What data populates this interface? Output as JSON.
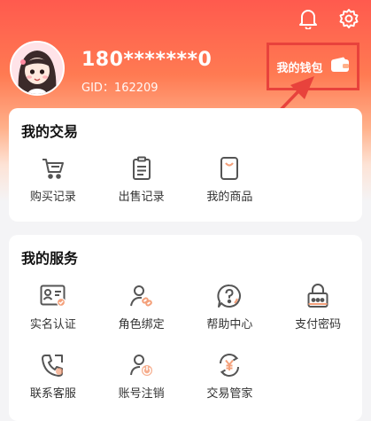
{
  "header": {
    "username": "180*******0",
    "gid": "GID：162209",
    "wallet_label": "我的钱包"
  },
  "top_icons": [
    "bell-icon",
    "gear-icon"
  ],
  "trade": {
    "title": "我的交易",
    "items": [
      {
        "label": "购买记录",
        "icon": "cart-icon"
      },
      {
        "label": "出售记录",
        "icon": "clipboard-icon"
      },
      {
        "label": "我的商品",
        "icon": "bag-icon"
      }
    ]
  },
  "service": {
    "title": "我的服务",
    "items": [
      {
        "label": "实名认证",
        "icon": "id-card-icon"
      },
      {
        "label": "角色绑定",
        "icon": "user-link-icon"
      },
      {
        "label": "帮助中心",
        "icon": "help-icon"
      },
      {
        "label": "支付密码",
        "icon": "lock-icon"
      },
      {
        "label": "联系客服",
        "icon": "phone-icon"
      },
      {
        "label": "账号注销",
        "icon": "user-power-icon"
      },
      {
        "label": "交易管家",
        "icon": "yen-cycle-icon"
      }
    ]
  },
  "colors": {
    "accent": "#ff5a4e",
    "highlight_border": "#e8423c",
    "icon_accent": "#f4a07a"
  }
}
